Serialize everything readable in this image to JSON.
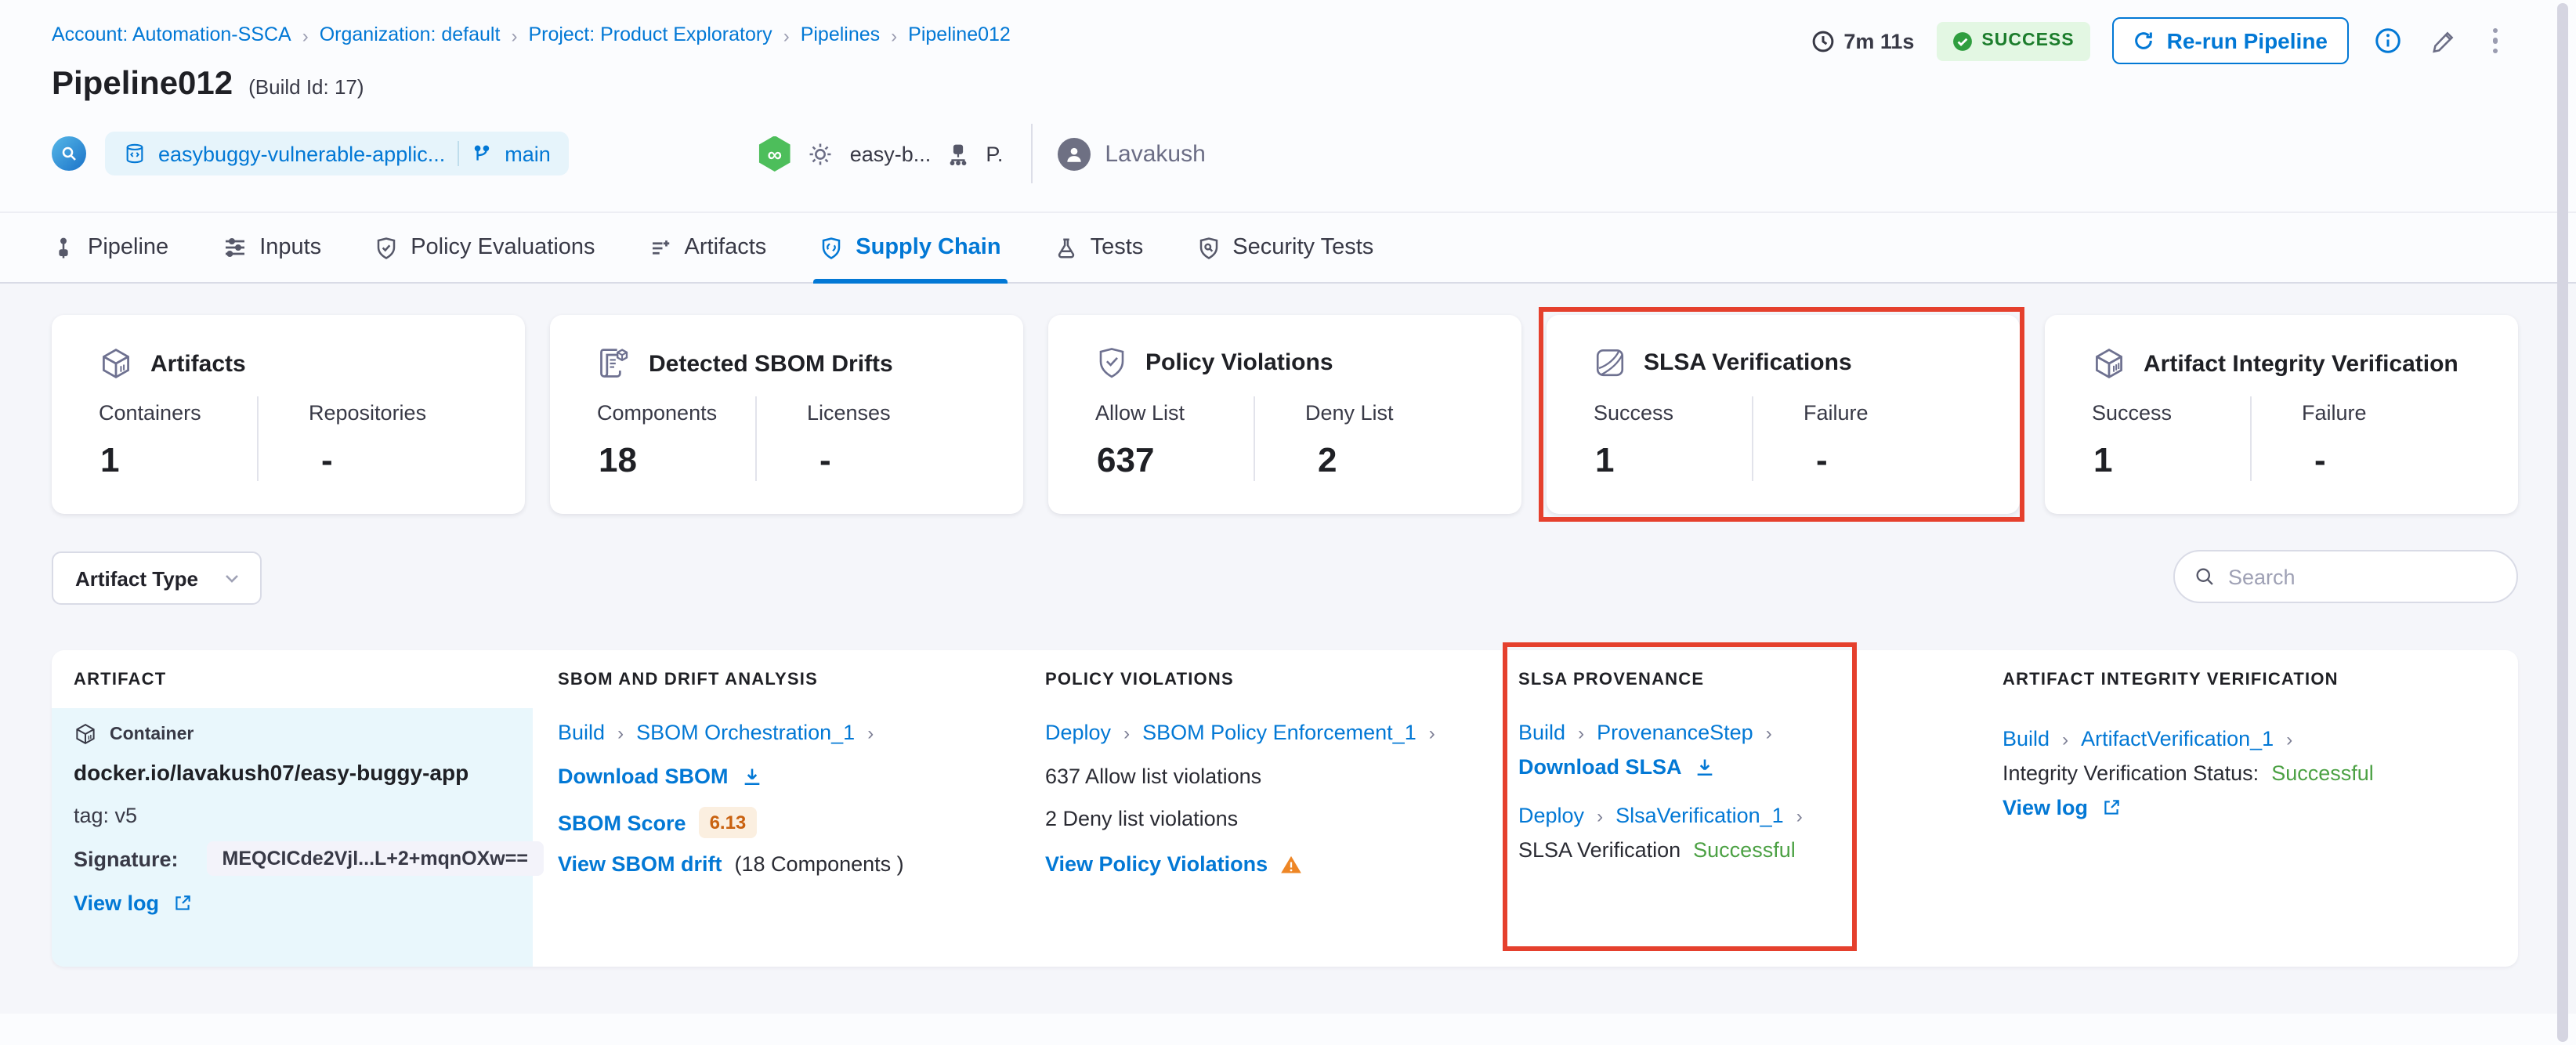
{
  "breadcrumb": {
    "items": [
      "Account: Automation-SSCA",
      "Organization: default",
      "Project: Product Exploratory",
      "Pipelines",
      "Pipeline012"
    ]
  },
  "header": {
    "duration": "7m 11s",
    "status": "SUCCESS",
    "rerun_label": "Re-run Pipeline",
    "title": "Pipeline012",
    "build_id": "(Build Id: 17)",
    "repo_name": "easybuggy-vulnerable-applic...",
    "branch": "main",
    "trigger_text": "easy-b...",
    "trigger_user_initial": "P.",
    "user_name": "Lavakush"
  },
  "tabs": [
    {
      "label": "Pipeline",
      "active": false
    },
    {
      "label": "Inputs",
      "active": false
    },
    {
      "label": "Policy Evaluations",
      "active": false
    },
    {
      "label": "Artifacts",
      "active": false
    },
    {
      "label": "Supply Chain",
      "active": true
    },
    {
      "label": "Tests",
      "active": false
    },
    {
      "label": "Security Tests",
      "active": false
    }
  ],
  "summary_cards": [
    {
      "title": "Artifacts",
      "icon": "cube-icon",
      "highlighted": false,
      "stats": [
        {
          "label": "Containers",
          "value": "1"
        },
        {
          "label": "Repositories",
          "value": "-"
        }
      ]
    },
    {
      "title": "Detected SBOM Drifts",
      "icon": "sbom-document-icon",
      "highlighted": false,
      "stats": [
        {
          "label": "Components",
          "value": "18"
        },
        {
          "label": "Licenses",
          "value": "-"
        }
      ]
    },
    {
      "title": "Policy Violations",
      "icon": "shield-check-icon",
      "highlighted": false,
      "stats": [
        {
          "label": "Allow List",
          "value": "637"
        },
        {
          "label": "Deny List",
          "value": "2"
        }
      ]
    },
    {
      "title": "SLSA Verifications",
      "icon": "slsa-icon",
      "highlighted": true,
      "stats": [
        {
          "label": "Success",
          "value": "1"
        },
        {
          "label": "Failure",
          "value": "-"
        }
      ]
    },
    {
      "title": "Artifact Integrity Verification",
      "icon": "cube-scan-icon",
      "highlighted": false,
      "stats": [
        {
          "label": "Success",
          "value": "1"
        },
        {
          "label": "Failure",
          "value": "-"
        }
      ]
    }
  ],
  "filters": {
    "artifact_type_label": "Artifact Type",
    "search_placeholder": "Search"
  },
  "table": {
    "columns": [
      "ARTIFACT",
      "SBOM AND DRIFT ANALYSIS",
      "POLICY VIOLATIONS",
      "SLSA PROVENANCE",
      "ARTIFACT INTEGRITY VERIFICATION"
    ],
    "row": {
      "artifact": {
        "type_label": "Container",
        "name": "docker.io/lavakush07/easy-buggy-app",
        "tag": "tag: v5",
        "signature_label": "Signature:",
        "signature_value": "MEQCICde2Vjl...L+2+mqnOXw==",
        "view_log_label": "View log"
      },
      "sbom": {
        "stage": "Build",
        "step": "SBOM Orchestration_1",
        "download_label": "Download SBOM",
        "score_label": "SBOM Score",
        "score_value": "6.13",
        "drift_link": "View SBOM drift",
        "drift_note": "(18 Components )"
      },
      "policy": {
        "stage": "Deploy",
        "step": "SBOM Policy Enforcement_1",
        "allow_text": "637 Allow list violations",
        "deny_text": "2 Deny list violations",
        "link": "View Policy Violations"
      },
      "slsa": {
        "stage1": "Build",
        "step1": "ProvenanceStep",
        "download_label": "Download SLSA",
        "stage2": "Deploy",
        "step2": "SlsaVerification_1",
        "status_prefix": "SLSA Verification",
        "status_value": "Successful"
      },
      "integrity": {
        "stage": "Build",
        "step": "ArtifactVerification_1",
        "status_prefix": "Integrity Verification Status:",
        "status_value": "Successful",
        "view_log_label": "View log"
      }
    }
  },
  "colors": {
    "accent_blue": "#0278D5",
    "highlight_red": "#E5402D",
    "success_text_green": "#4CA144",
    "status_badge_green": "#1C7D2C",
    "status_badge_bg": "#E3F7E3",
    "score_badge_orange": "#C9610F",
    "score_badge_bg": "#FBEFE0",
    "artifact_cell_bg": "#E9F7FC",
    "warning_orange": "#EE8625"
  }
}
